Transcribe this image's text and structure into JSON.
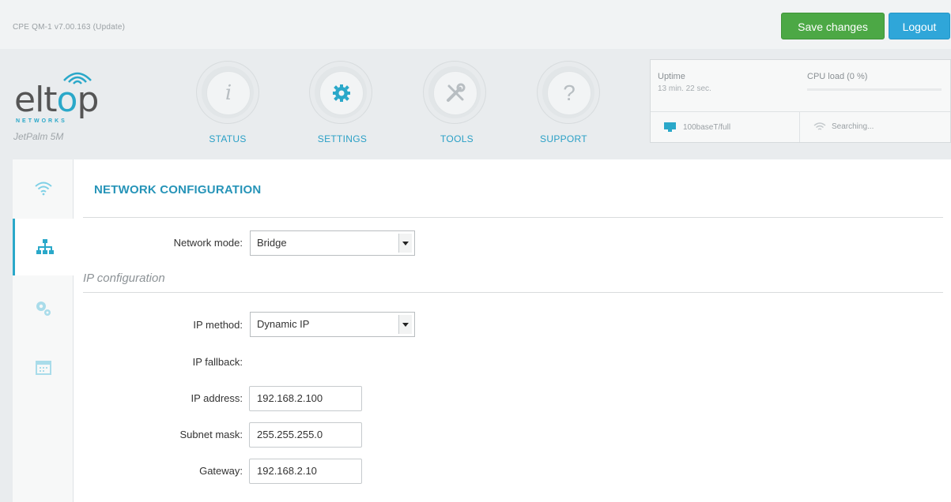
{
  "topbar": {
    "version": "CPE QM-1 v7.00.163 (Update)",
    "save_label": "Save changes",
    "logout_label": "Logout",
    "save_color": "#4ca845",
    "logout_color": "#2fa6d9"
  },
  "brand": {
    "logo_pre": "elt",
    "logo_o": "o",
    "logo_post": "p",
    "networks": "NETWORKS",
    "model": "JetPalm 5M"
  },
  "nav": [
    {
      "label": "STATUS",
      "icon": "info-icon"
    },
    {
      "label": "SETTINGS",
      "icon": "gear-icon"
    },
    {
      "label": "TOOLS",
      "icon": "tools-icon"
    },
    {
      "label": "SUPPORT",
      "icon": "question-icon"
    }
  ],
  "status": {
    "uptime_title": "Uptime",
    "uptime_value": "13 min. 22 sec.",
    "cpu_title": "CPU load (0 %)",
    "cpu_load": 0,
    "link": "100baseT/full",
    "wifi": "Searching..."
  },
  "sidenav": [
    {
      "icon": "wifi-icon"
    },
    {
      "icon": "network-icon",
      "active": true
    },
    {
      "icon": "gears-icon"
    },
    {
      "icon": "calendar-icon"
    }
  ],
  "main": {
    "title": "NETWORK CONFIGURATION",
    "network_mode_label": "Network mode:",
    "network_mode_value": "Bridge",
    "ip_section": "IP configuration",
    "ip_method_label": "IP method:",
    "ip_method_value": "Dynamic IP",
    "ip_fallback_label": "IP fallback:",
    "ip_address_label": "IP address:",
    "ip_address_value": "192.168.2.100",
    "subnet_label": "Subnet mask:",
    "subnet_value": "255.255.255.0",
    "gateway_label": "Gateway:",
    "gateway_value": "192.168.2.10"
  }
}
